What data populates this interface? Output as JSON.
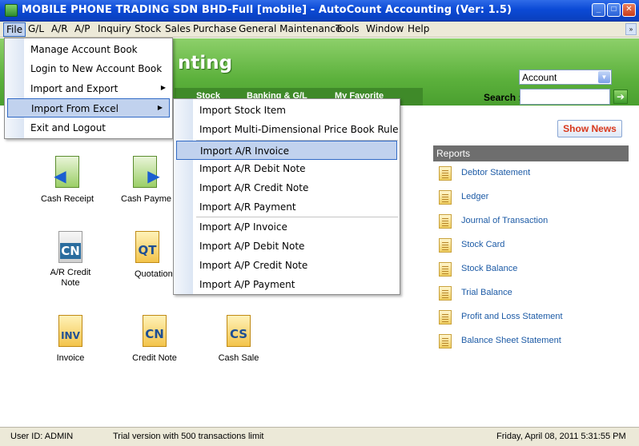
{
  "window": {
    "title": "MOBILE PHONE TRADING SDN  BHD-Full [mobile] - AutoCount Accounting (Ver: 1.5)",
    "minimize": "_",
    "maximize": "□",
    "close": "✕"
  },
  "menubar": {
    "items": [
      "File",
      "G/L",
      "A/R",
      "A/P",
      "Inquiry",
      "Stock",
      "Sales",
      "Purchase",
      "General Maintenance",
      "Tools",
      "Window",
      "Help"
    ],
    "collapse": "»"
  },
  "header": {
    "brand": "nting",
    "tabs": [
      "Stock",
      "Banking & G/L",
      "My Favorite"
    ],
    "account_select": "Account",
    "search_label": "Search :",
    "search_value": "",
    "go_symbol": "➔"
  },
  "file_menu": [
    {
      "label": "Manage Account Book",
      "submenu": false
    },
    {
      "label": "Login to New Account Book",
      "submenu": false
    },
    {
      "label": "Import and Export",
      "submenu": true
    },
    {
      "label": "Import From Excel",
      "submenu": true
    },
    {
      "label": "Exit and Logout",
      "submenu": false
    }
  ],
  "submenu_arrow": "▶",
  "import_menu": [
    "Import Stock Item",
    "Import Multi-Dimensional Price Book Rule",
    "Import A/R Invoice",
    "Import A/R Debit Note",
    "Import A/R Credit Note",
    "Import A/R Payment",
    "Import A/P Invoice",
    "Import A/P Debit Note",
    "Import A/P Credit Note",
    "Import A/P Payment"
  ],
  "tiles": {
    "cash_receipt": "Cash Receipt",
    "cash_payment": "Cash Payme",
    "ar_credit_note_1": "A/R Credit",
    "ar_credit_note_2": "Note",
    "quotation": "Quotation",
    "invoice": "Invoice",
    "credit_note": "Credit Note",
    "cash_sale": "Cash Sale",
    "codes": {
      "cn": "CN",
      "qt": "QT",
      "inv": "INV",
      "cs": "CS"
    }
  },
  "show_news": "Show News",
  "reports": {
    "title": "Reports",
    "items": [
      "Debtor Statement",
      "Ledger",
      "Journal of Transaction",
      "Stock Card",
      "Stock Balance",
      "Trial Balance",
      "Profit and Loss Statement",
      "Balance Sheet Statement"
    ]
  },
  "status": {
    "user": "User ID: ADMIN",
    "trial": "Trial version with 500 transactions limit",
    "datetime": "Friday, April 08, 2011   5:31:55 PM"
  }
}
